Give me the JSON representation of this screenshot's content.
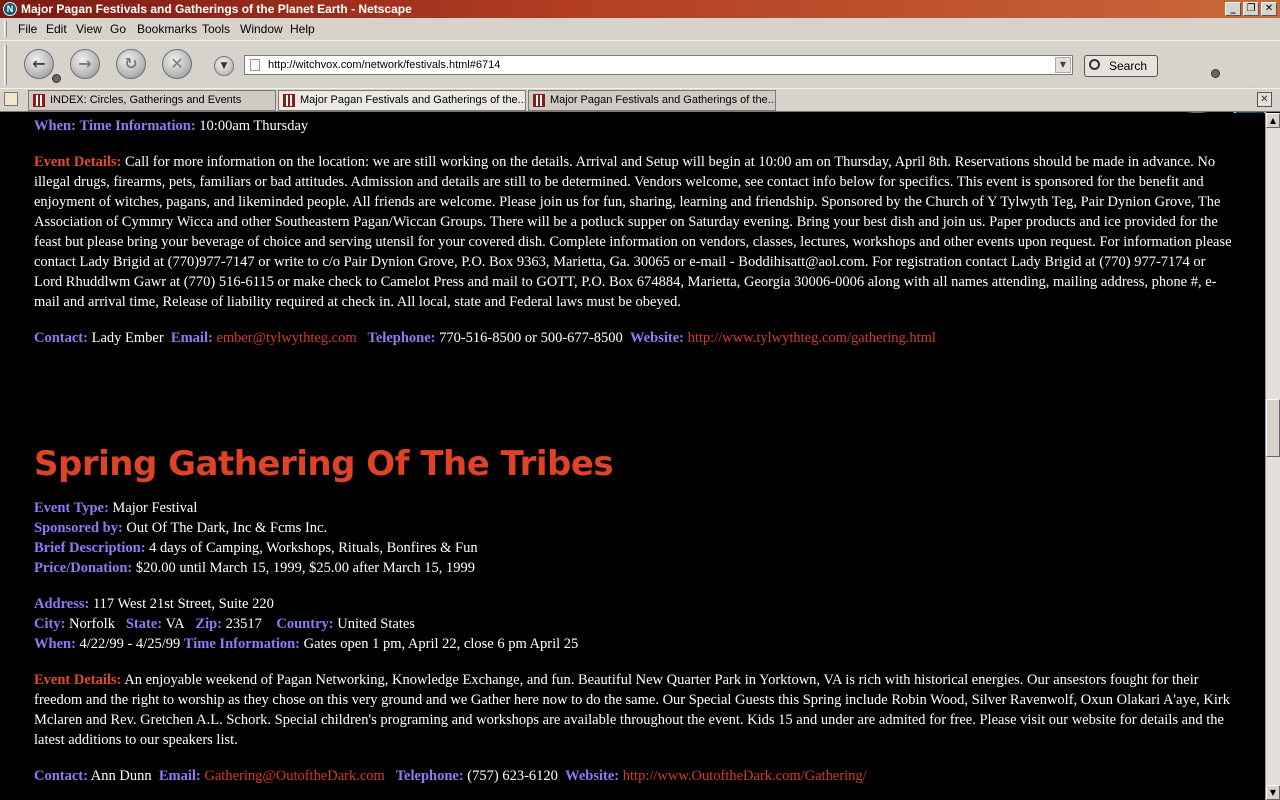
{
  "window": {
    "title": "Major Pagan Festivals and Gatherings of the Planet Earth - Netscape",
    "app_icon": "netscape-n-icon",
    "controls": [
      "_",
      "❐",
      "✕"
    ]
  },
  "menu": [
    "File",
    "Edit",
    "View",
    "Go",
    "Bookmarks",
    "Tools",
    "Window",
    "Help"
  ],
  "toolbar": {
    "back_icon": "←",
    "forward_icon": "→",
    "reload_icon": "↻",
    "stop_icon": "✕",
    "url": "http://witchvox.com/network/festivals.html#6714",
    "search_label": "Search",
    "logo_letter": "N"
  },
  "tabs": [
    {
      "label": "INDEX: Circles, Gatherings and Events",
      "active": false
    },
    {
      "label": "Major Pagan Festivals and Gatherings of the...",
      "active": true
    },
    {
      "label": "Major Pagan Festivals and Gatherings of the...",
      "active": false
    }
  ],
  "event1": {
    "when_label": "When:",
    "time_info_label": "Time Information:",
    "time_info": "10:00am Thursday",
    "details_label": "Event Details:",
    "details": "Call for more information on the location: we are still working on the details. Arrival and Setup will begin at 10:00 am on Thursday, April 8th. Reservations should be made in advance. No illegal drugs, firearms, pets, familiars or bad attitudes. Admission and details are still to be determined. Vendors welcome, see contact info below for specifics. This event is sponsored for the benefit and enjoyment of witches, pagans, and likeminded people. All friends are welcome. Please join us for fun, sharing, learning and friendship. Sponsored by the Church of Y Tylwyth Teg, Pair Dynion Grove, The Association of Cymmry Wicca and other Southeastern Pagan/Wiccan Groups. There will be a potluck supper on Saturday evening. Bring your best dish and join us. Paper products and ice provided for the feast but please bring your beverage of choice and serving utensil for your covered dish. Complete information on vendors, classes, lectures, workshops and other events upon request. For information please contact Lady Brigid at (770)977-7147 or write to c/o Pair Dynion Grove, P.O. Box 9363, Marietta, Ga. 30065 or e-mail - Boddihisatt@aol.com. For registration contact Lady Brigid at (770) 977-7174 or Lord Rhuddlwm Gawr at (770) 516-6115 or make check to Camelot Press and mail to GOTT, P.O. Box 674884, Marietta, Georgia 30006-0006 along with all names attending, mailing address, phone #, e-mail and arrival time, Release of liability required at check in. All local, state and Federal laws must be obeyed.",
    "contact_label": "Contact:",
    "contact": "Lady Ember",
    "email_label": "Email:",
    "email": "ember@tylwythteg.com",
    "phone_label": "Telephone:",
    "phone": "770-516-8500 or 500-677-8500",
    "website_label": "Website:",
    "website": "http://www.tylwythteg.com/gathering.html"
  },
  "event2": {
    "title": "Spring Gathering Of The Tribes",
    "type_label": "Event Type:",
    "type": "Major Festival",
    "sponsor_label": "Sponsored by:",
    "sponsor": "Out Of The Dark, Inc & Fcms Inc.",
    "brief_label": "Brief Description:",
    "brief": "4 days of Camping, Workshops, Rituals, Bonfires & Fun",
    "price_label": "Price/Donation:",
    "price": "$20.00 until March 15, 1999, $25.00 after March 15, 1999",
    "address_label": "Address:",
    "address": "117 West 21st Street, Suite 220",
    "city_label": "City:",
    "city": "Norfolk",
    "state_label": "State:",
    "state": "VA",
    "zip_label": "Zip:",
    "zip": "23517",
    "country_label": "Country:",
    "country": "United States",
    "when_label": "When:",
    "when": "4/22/99 - 4/25/99",
    "time_info_label": "Time Information:",
    "time_info": "Gates open 1 pm, April 22, close 6 pm April 25",
    "details_label": "Event Details:",
    "details": "An enjoyable weekend of Pagan Networking, Knowledge Exchange, and fun. Beautiful New Quarter Park in Yorktown, VA is rich with historical energies. Our ansestors fought for their freedom and the right to worship as they chose on this very ground and we Gather here now to do the same. Our Special Guests this Spring include Robin Wood, Silver Ravenwolf, Oxun Olakari A'aye, Kirk Mclaren and Rev. Gretchen A.L. Schork. Special children's programing and workshops are available throughout the event. Kids 15 and under are admited for free. Please visit our website for details and the latest additions to our speakers list.",
    "contact_label": "Contact:",
    "contact": "Ann Dunn",
    "email_label": "Email:",
    "email": "Gathering@OutoftheDark.com",
    "phone_label": "Telephone:",
    "phone": "(757) 623-6120",
    "website_label": "Website:",
    "website": "http://www.OutoftheDark.com/Gathering/"
  },
  "scrollbar": {
    "up_icon": "▲",
    "down_icon": "▼"
  },
  "colors": {
    "label": "#8f7cf2",
    "details_label": "#e04c30",
    "link": "#d23b28",
    "heading": "#de4328",
    "background": "#000000"
  }
}
